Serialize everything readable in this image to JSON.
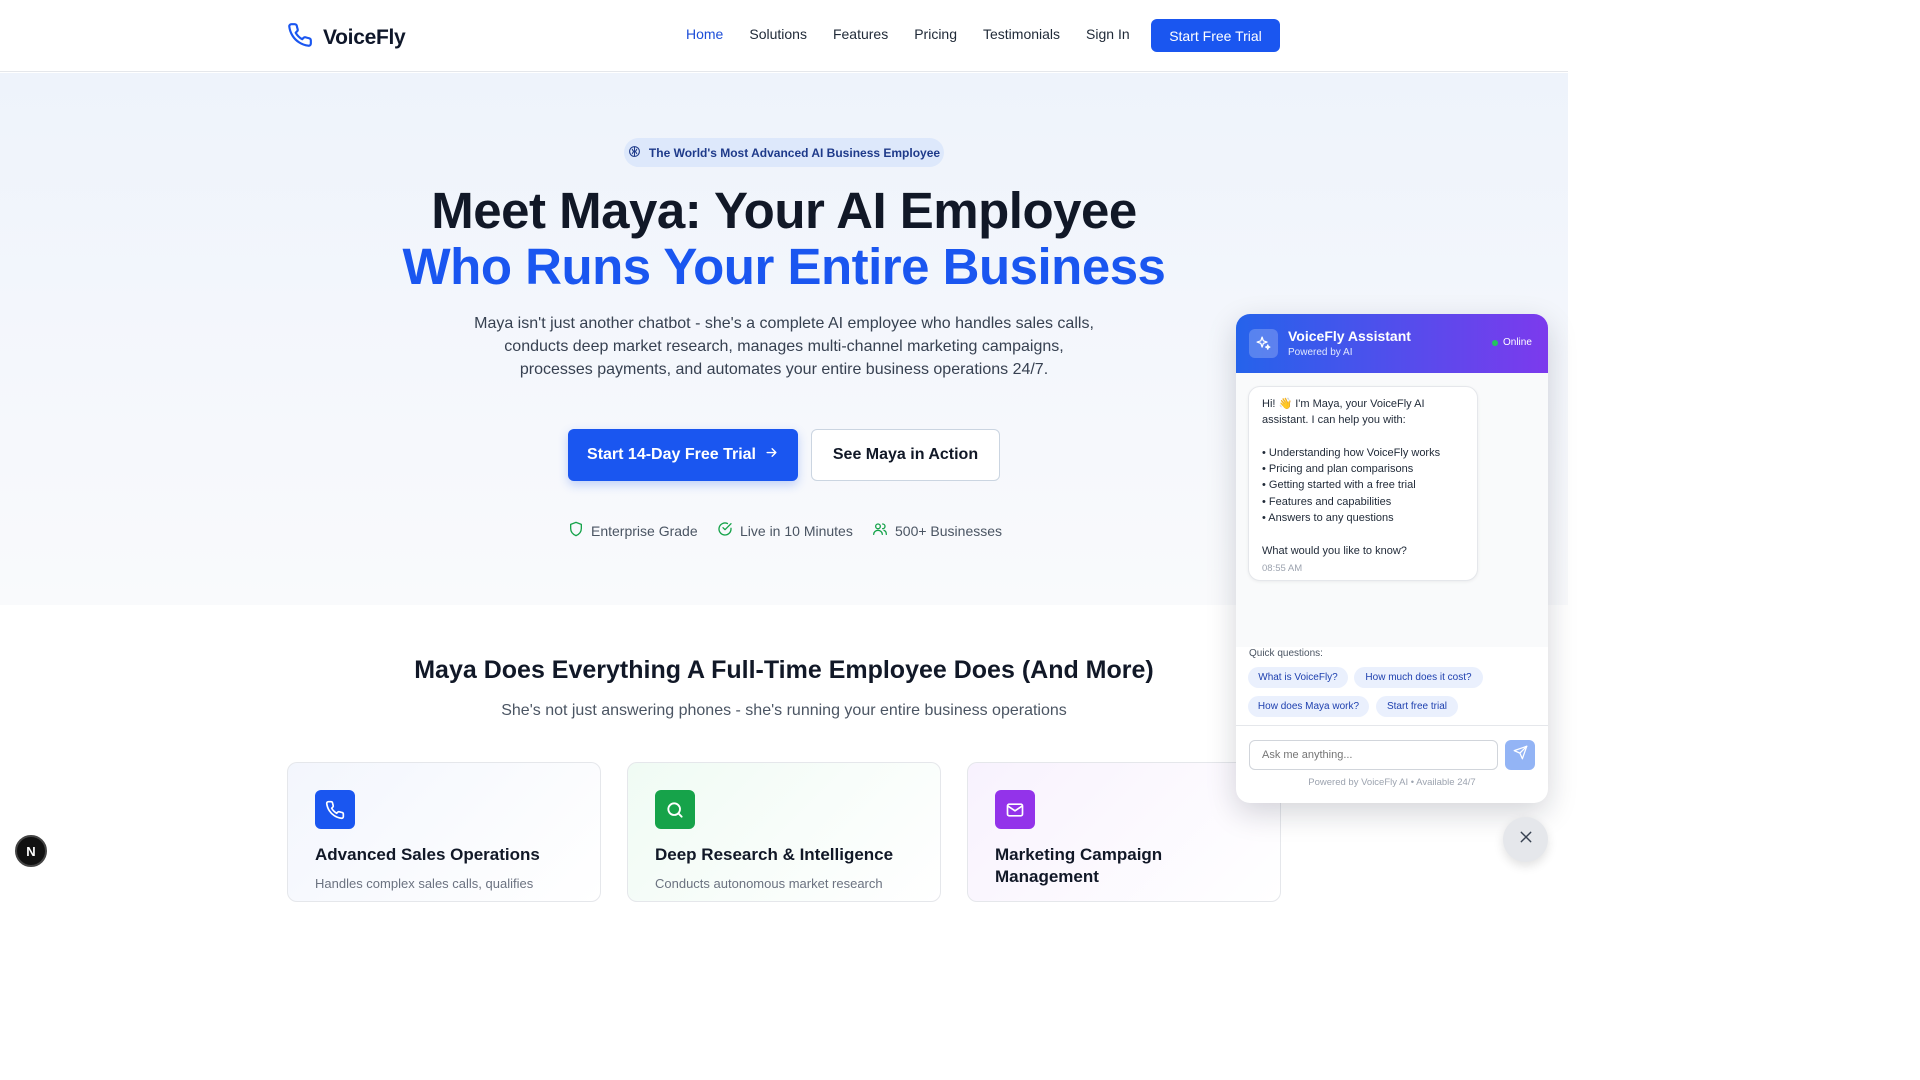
{
  "nav": {
    "brand": "VoiceFly",
    "links": [
      "Home",
      "Solutions",
      "Features",
      "Pricing",
      "Testimonials",
      "Sign In"
    ],
    "cta": "Start Free Trial"
  },
  "hero": {
    "badge": "The World's Most Advanced AI Business Employee",
    "title_line1": "Meet Maya: Your AI Employee",
    "title_line2": "Who Runs Your Entire Business",
    "lead": "Maya isn't just another chatbot - she's a complete AI employee who handles sales calls, conducts deep market research, manages multi-channel marketing campaigns, processes payments, and automates your entire business operations 24/7.",
    "primary_cta": "Start 14-Day Free Trial",
    "secondary_cta": "See Maya in Action",
    "trust": [
      "Enterprise Grade",
      "Live in 10 Minutes",
      "500+ Businesses"
    ]
  },
  "features": {
    "title": "Maya Does Everything A Full-Time Employee Does (And More)",
    "subtitle": "She's not just answering phones - she's running your entire business operations",
    "cards": [
      {
        "title": "Advanced Sales Operations",
        "desc": "Handles complex sales calls, qualifies",
        "icon": "phone-icon",
        "color": "#1a56f0"
      },
      {
        "title": "Deep Research & Intelligence",
        "desc": "Conducts autonomous market research",
        "icon": "search-icon",
        "color": "#16a34a"
      },
      {
        "title": "Marketing Campaign Management",
        "desc": "",
        "icon": "mail-icon",
        "color": "#9333ea"
      }
    ]
  },
  "chat": {
    "title": "VoiceFly Assistant",
    "powered": "Powered by AI",
    "status": "Online",
    "message": {
      "intro": "Hi! 👋 I'm Maya, your VoiceFly AI assistant. I can help you with:",
      "items": [
        "• Understanding how VoiceFly works",
        "• Pricing and plan comparisons",
        "• Getting started with a free trial",
        "• Features and capabilities",
        "• Answers to any questions"
      ],
      "question": "What would you like to know?",
      "time": "08:55 AM"
    },
    "quick_label": "Quick questions:",
    "quick": [
      "What is VoiceFly?",
      "How much does it cost?",
      "How does Maya work?",
      "Start free trial"
    ],
    "input_placeholder": "Ask me anything...",
    "footer": "Powered by VoiceFly AI • Available 24/7"
  },
  "dev_badge": "N"
}
